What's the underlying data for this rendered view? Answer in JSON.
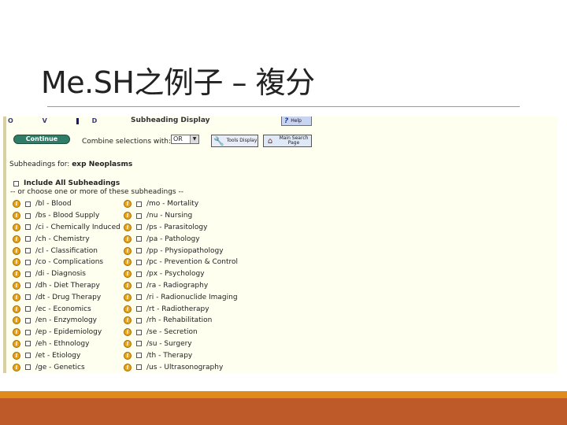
{
  "slide": {
    "title": "Me.SH之例子 – 複分"
  },
  "ovid_logo": "OVID",
  "header": {
    "title": "Subheading Display",
    "help_label": "Help"
  },
  "controls": {
    "continue_label": "Continue",
    "combine_label": "Combine selections with:",
    "combine_value": "OR",
    "tools_label": "Tools Display",
    "main_label": "Main Search Page"
  },
  "subheadings_for": {
    "prefix": "Subheadings for:",
    "term": "exp Neoplasms"
  },
  "include_all_label": "Include All Subheadings",
  "choose_text": "-- or choose one or more of these subheadings --",
  "subheadings_left": [
    "/bl - Blood",
    "/bs - Blood Supply",
    "/ci - Chemically Induced",
    "/ch - Chemistry",
    "/cl - Classification",
    "/co - Complications",
    "/di - Diagnosis",
    "/dh - Diet Therapy",
    "/dt - Drug Therapy",
    "/ec - Economics",
    "/en - Enzymology",
    "/ep - Epidemiology",
    "/eh - Ethnology",
    "/et - Etiology",
    "/ge - Genetics"
  ],
  "subheadings_right": [
    "/mo - Mortality",
    "/nu - Nursing",
    "/ps - Parasitology",
    "/pa - Pathology",
    "/pp - Physiopathology",
    "/pc - Prevention & Control",
    "/px - Psychology",
    "/ra - Radiography",
    "/ri - Radionuclide Imaging",
    "/rt - Radiotherapy",
    "/rh - Rehabilitation",
    "/se - Secretion",
    "/su - Surgery",
    "/th - Therapy",
    "/us - Ultrasonography"
  ],
  "colors": {
    "accent_gold": "#e08a1c",
    "accent_rust": "#be5a2a",
    "panel_bg": "#fffff0",
    "continue_button": "#2f7d66",
    "info_icon": "#e9a318"
  }
}
